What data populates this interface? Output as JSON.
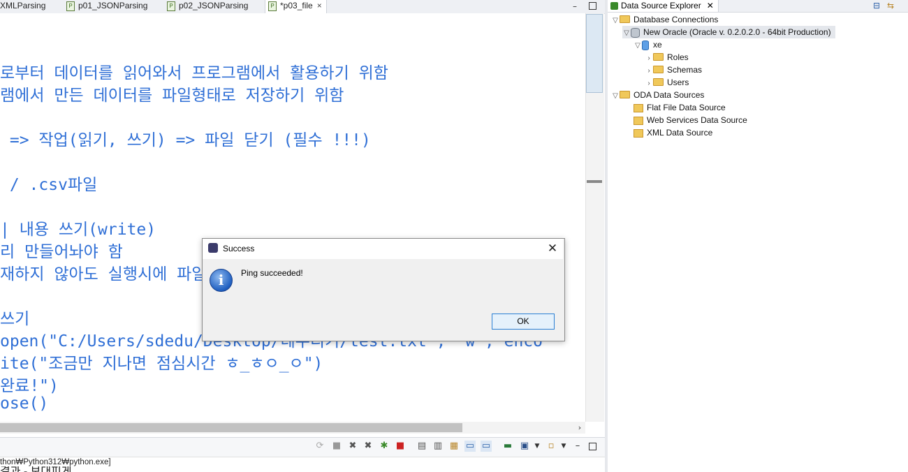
{
  "editor": {
    "tabs": [
      {
        "label": "XMLParsing",
        "active": false
      },
      {
        "label": "p01_JSONParsing",
        "active": false
      },
      {
        "label": "p02_JSONParsing",
        "active": false
      },
      {
        "label": "*p03_file",
        "active": true
      }
    ],
    "tab_close_glyph": "×",
    "code_lines": [
      "로부터 데이터를 읽어와서 프로그램에서 활용하기 위함",
      "램에서 만든 데이터를 파일형태로 저장하기 위함",
      "",
      " => 작업(읽기, 쓰기) => 파일 닫기 (필수 !!!)",
      "",
      " / .csv파일",
      "",
      "| 내용 쓰기(write)",
      "리 만들어놔야 함",
      "재하지 않아도 실행시에 파일",
      "",
      "쓰기",
      "open(\"C:/Users/sdedu/Desktop/데우디기/test.txt\", \"w\", enco",
      "ite(\"조금만 지나면 점심시간 ㅎ_ㅎㅇ_ㅇ\")",
      "완료!\")",
      "ose()"
    ]
  },
  "console": {
    "path": "thon₩Python312₩python.exe]",
    "partial_text": "결과 - 보대피게"
  },
  "data_source_explorer": {
    "tab_label": "Data Source Explorer",
    "tree": [
      {
        "label": "Database Connections",
        "expanded": true
      },
      {
        "label": "New Oracle (Oracle v. 0.2.0.2.0 - 64bit Production)",
        "expanded": true,
        "selected": true
      },
      {
        "label": "xe",
        "expanded": true
      },
      {
        "label": "Roles",
        "expanded": false
      },
      {
        "label": "Schemas",
        "expanded": false
      },
      {
        "label": "Users",
        "expanded": false
      },
      {
        "label": "ODA Data Sources",
        "expanded": true
      },
      {
        "label": "Flat File Data Source"
      },
      {
        "label": "Web Services Data Source"
      },
      {
        "label": "XML Data Source"
      }
    ]
  },
  "dialog": {
    "title": "Success",
    "message": "Ping succeeded!",
    "ok_label": "OK",
    "close_glyph": "✕",
    "info_glyph": "i"
  },
  "colors": {
    "code_text": "#2f6fd6",
    "ok_border": "#2a7fd4"
  }
}
